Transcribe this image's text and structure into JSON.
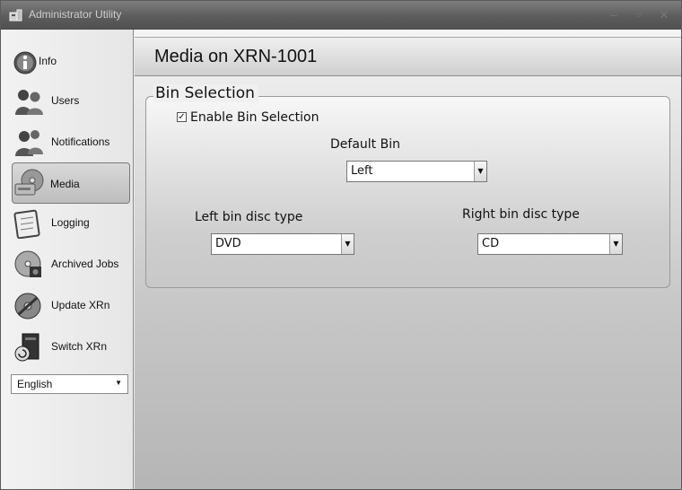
{
  "window": {
    "title": "Administrator Utility"
  },
  "sidebar": {
    "items": [
      {
        "label": "Info"
      },
      {
        "label": "Users"
      },
      {
        "label": "Notifications"
      },
      {
        "label": "Media"
      },
      {
        "label": "Logging"
      },
      {
        "label": "Archived Jobs"
      },
      {
        "label": "Update XRn"
      },
      {
        "label": "Switch XRn"
      }
    ],
    "selected": "Media",
    "language": {
      "value": "English"
    }
  },
  "main": {
    "title": "Media on XRN-1001",
    "bin_group": {
      "title": "Bin Selection",
      "enable_label": "Enable Bin Selection",
      "enable_checked": true,
      "default_bin": {
        "label": "Default Bin",
        "value": "Left"
      },
      "left_disc": {
        "label": "Left bin disc type",
        "value": "DVD"
      },
      "right_disc": {
        "label": "Right bin disc type",
        "value": "CD"
      }
    }
  }
}
